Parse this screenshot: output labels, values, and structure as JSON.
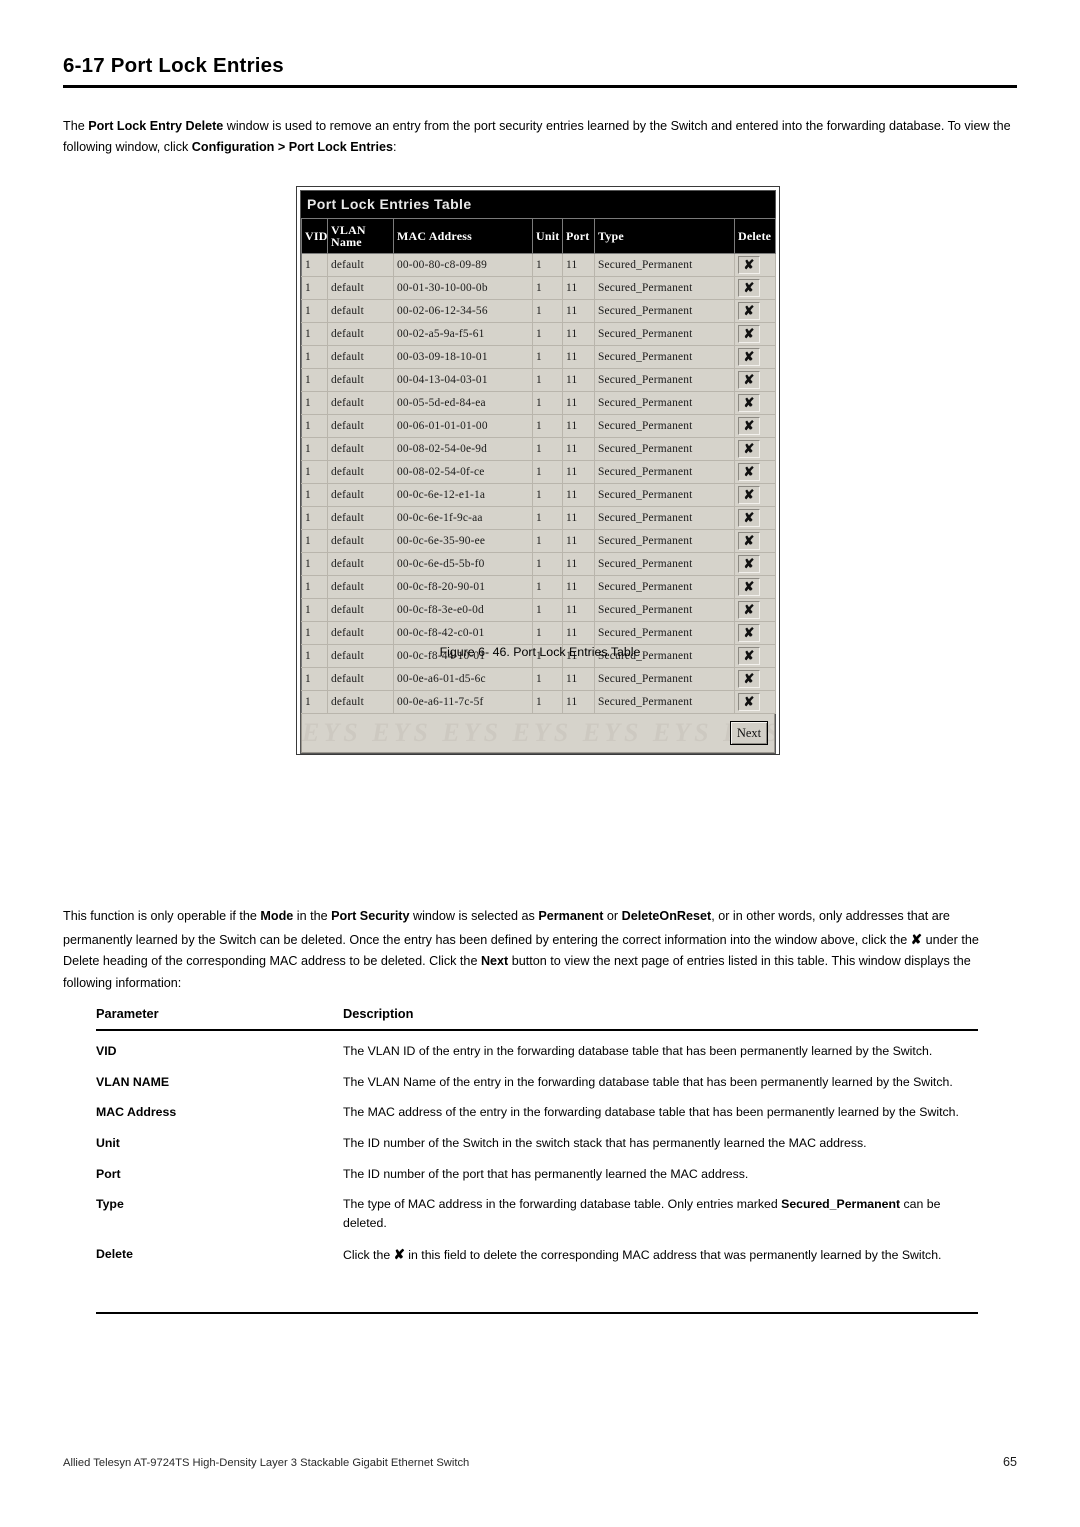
{
  "section": {
    "number": "6-17",
    "title": "Port Lock Entries",
    "heading_full": "6-17 Port Lock Entries"
  },
  "intro": {
    "part1": "The ",
    "bold1": "Port Lock Entry Delete",
    "part2": " window is used to remove an entry from the port security entries learned by the Switch and entered into the forwarding database. To view the following window, click ",
    "bold2": "Configuration > Port Lock Entries",
    "part3": ":"
  },
  "screenshot": {
    "window_title": "Port Lock Entries Table",
    "watermark": "EYS EYS EYS EYS EYS EYS EYS EYS",
    "next_button": "Next",
    "delete_glyph": "✘",
    "columns": [
      "VID",
      "VLAN Name",
      "MAC Address",
      "Unit",
      "Port",
      "Type",
      "Delete"
    ],
    "column_vlan_line1": "VLAN",
    "column_vlan_line2": "Name",
    "rows": [
      {
        "vid": "1",
        "vlan": "default",
        "mac": "00-00-80-c8-09-89",
        "unit": "1",
        "port": "11",
        "type": "Secured_Permanent"
      },
      {
        "vid": "1",
        "vlan": "default",
        "mac": "00-01-30-10-00-0b",
        "unit": "1",
        "port": "11",
        "type": "Secured_Permanent"
      },
      {
        "vid": "1",
        "vlan": "default",
        "mac": "00-02-06-12-34-56",
        "unit": "1",
        "port": "11",
        "type": "Secured_Permanent"
      },
      {
        "vid": "1",
        "vlan": "default",
        "mac": "00-02-a5-9a-f5-61",
        "unit": "1",
        "port": "11",
        "type": "Secured_Permanent"
      },
      {
        "vid": "1",
        "vlan": "default",
        "mac": "00-03-09-18-10-01",
        "unit": "1",
        "port": "11",
        "type": "Secured_Permanent"
      },
      {
        "vid": "1",
        "vlan": "default",
        "mac": "00-04-13-04-03-01",
        "unit": "1",
        "port": "11",
        "type": "Secured_Permanent"
      },
      {
        "vid": "1",
        "vlan": "default",
        "mac": "00-05-5d-ed-84-ea",
        "unit": "1",
        "port": "11",
        "type": "Secured_Permanent"
      },
      {
        "vid": "1",
        "vlan": "default",
        "mac": "00-06-01-01-01-00",
        "unit": "1",
        "port": "11",
        "type": "Secured_Permanent"
      },
      {
        "vid": "1",
        "vlan": "default",
        "mac": "00-08-02-54-0e-9d",
        "unit": "1",
        "port": "11",
        "type": "Secured_Permanent"
      },
      {
        "vid": "1",
        "vlan": "default",
        "mac": "00-08-02-54-0f-ce",
        "unit": "1",
        "port": "11",
        "type": "Secured_Permanent"
      },
      {
        "vid": "1",
        "vlan": "default",
        "mac": "00-0c-6e-12-e1-1a",
        "unit": "1",
        "port": "11",
        "type": "Secured_Permanent"
      },
      {
        "vid": "1",
        "vlan": "default",
        "mac": "00-0c-6e-1f-9c-aa",
        "unit": "1",
        "port": "11",
        "type": "Secured_Permanent"
      },
      {
        "vid": "1",
        "vlan": "default",
        "mac": "00-0c-6e-35-90-ee",
        "unit": "1",
        "port": "11",
        "type": "Secured_Permanent"
      },
      {
        "vid": "1",
        "vlan": "default",
        "mac": "00-0c-6e-d5-5b-f0",
        "unit": "1",
        "port": "11",
        "type": "Secured_Permanent"
      },
      {
        "vid": "1",
        "vlan": "default",
        "mac": "00-0c-f8-20-90-01",
        "unit": "1",
        "port": "11",
        "type": "Secured_Permanent"
      },
      {
        "vid": "1",
        "vlan": "default",
        "mac": "00-0c-f8-3e-e0-0d",
        "unit": "1",
        "port": "11",
        "type": "Secured_Permanent"
      },
      {
        "vid": "1",
        "vlan": "default",
        "mac": "00-0c-f8-42-c0-01",
        "unit": "1",
        "port": "11",
        "type": "Secured_Permanent"
      },
      {
        "vid": "1",
        "vlan": "default",
        "mac": "00-0c-f8-44-10-01",
        "unit": "1",
        "port": "11",
        "type": "Secured_Permanent"
      },
      {
        "vid": "1",
        "vlan": "default",
        "mac": "00-0e-a6-01-d5-6c",
        "unit": "1",
        "port": "11",
        "type": "Secured_Permanent"
      },
      {
        "vid": "1",
        "vlan": "default",
        "mac": "00-0e-a6-11-7c-5f",
        "unit": "1",
        "port": "11",
        "type": "Secured_Permanent"
      }
    ]
  },
  "figure_caption": "Figure 6- 46. Port Lock Entries Table",
  "body_para": {
    "s1": "This function is only operable if the ",
    "b1": "Mode",
    "s2": " in the ",
    "b2": "Port Security",
    "s3": " window is selected as ",
    "b3": "Permanent",
    "s4": " or ",
    "b4": "DeleteOnReset",
    "s5": ", or in other words, only addresses that are permanently learned by the Switch can be deleted. Once the entry has been defined by entering the correct information into the window above, click the ",
    "x": "✘",
    "s6": " under the Delete heading of the corresponding MAC address to be deleted. Click the ",
    "b5": "Next",
    "s7": " button to view the next page of entries listed in this table. This window displays the following information:"
  },
  "param_table": {
    "headers": [
      "Parameter",
      "Description"
    ],
    "rows": [
      {
        "name": "VID",
        "desc": "The VLAN ID of the entry in the forwarding database table that has been permanently learned by the Switch."
      },
      {
        "name": "VLAN NAME",
        "desc": "The VLAN Name of the entry in the forwarding database table that has been permanently learned by the Switch."
      },
      {
        "name": "MAC Address",
        "desc": "The MAC address of the entry in the forwarding database table that has been permanently learned by the Switch."
      },
      {
        "name": "Unit",
        "desc": "The ID number of the Switch in the switch stack that has permanently learned the MAC address."
      },
      {
        "name": "Port",
        "desc": "The ID number of the port that has permanently learned the MAC address."
      },
      {
        "name": "Type",
        "desc_pre": "The type of MAC address in the forwarding database table. Only entries marked ",
        "desc_bold": "Secured_Permanent",
        "desc_post": " can be deleted."
      },
      {
        "name": "Delete",
        "desc_pre": "Click the ",
        "desc_glyph": "✘",
        "desc_post": " in this field to delete the corresponding MAC address that was permanently learned by the Switch."
      }
    ]
  },
  "footer": {
    "product": "Allied Telesyn AT-9724TS High-Density Layer 3 Stackable Gigabit Ethernet Switch",
    "page_number": "65"
  }
}
